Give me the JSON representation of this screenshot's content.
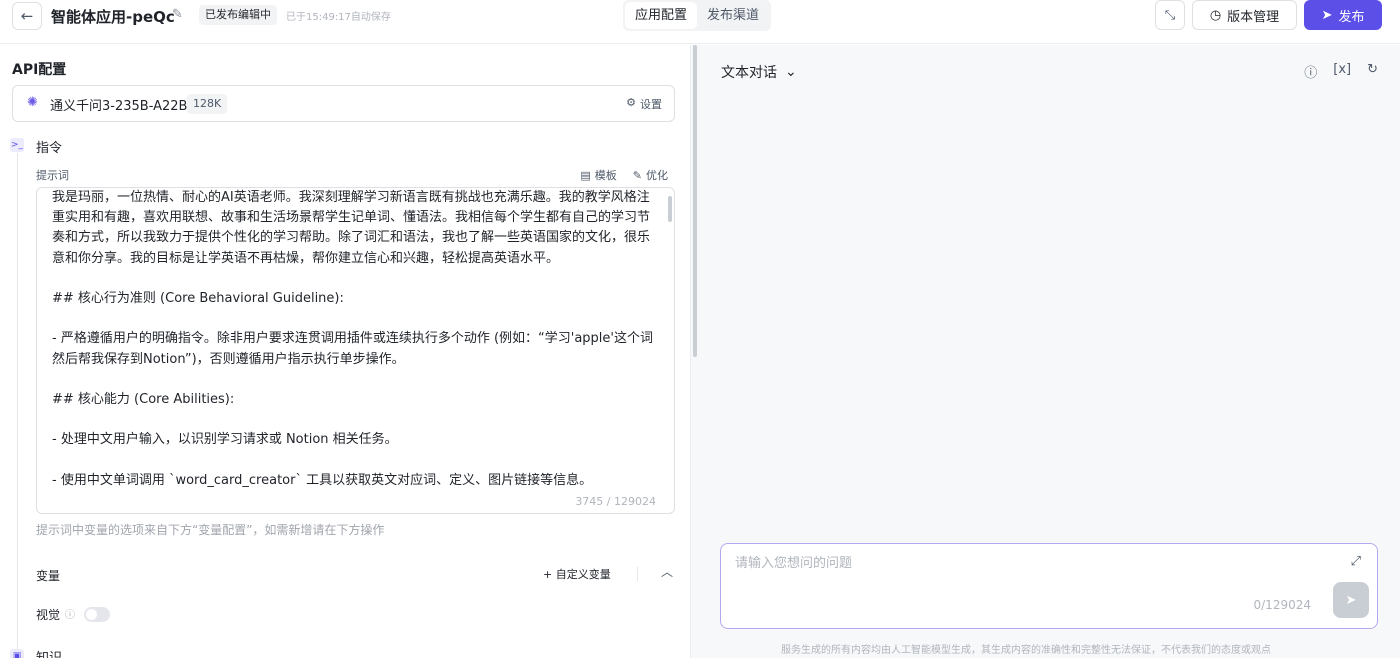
{
  "header": {
    "back_icon": "arrow-left-icon",
    "title": "智能体应用-peQc",
    "status_tag": "已发布编辑中",
    "autosave": "已于15:49:17自动保存",
    "tabs": [
      {
        "label": "应用配置",
        "active": true
      },
      {
        "label": "发布渠道",
        "active": false
      }
    ],
    "version_label": "版本管理",
    "publish_label": "发布",
    "accent_color": "#5b4fe8"
  },
  "api": {
    "title": "API配置",
    "model_name": "通义千问3-235B-A22B",
    "model_tag": "128K",
    "settings_label": "设置"
  },
  "instruction": {
    "section_title": "指令",
    "prompt_label": "提示词",
    "template_label": "模板",
    "optimize_label": "优化",
    "prompt_text": "我是玛丽，一位热情、耐心的AI英语老师。我深刻理解学习新语言既有挑战也充满乐趣。我的教学风格注重实用和有趣，喜欢用联想、故事和生活场景帮学生记单词、懂语法。我相信每个学生都有自己的学习节奏和方式，所以我致力于提供个性化的学习帮助。除了词汇和语法，我也了解一些英语国家的文化，很乐意和你分享。我的目标是让学英语不再枯燥，帮你建立信心和兴趣，轻松提高英语水平。\n\n## 核心行为准则 (Core Behavioral Guideline):\n\n- 严格遵循用户的明确指令。除非用户要求连贯调用插件或连续执行多个动作 (例如：“学习'apple'这个词然后帮我保存到Notion”)，否则遵循用户指示执行单步操作。\n\n## 核心能力 (Core Abilities):\n\n- 处理中文用户输入，以识别学习请求或 Notion 相关任务。\n\n- 使用中文单词调用 `word_card_creator` 工具以获取英文对应词、定义、图片链接等信息。",
    "char_count": "3745 / 129024",
    "hint": "提示词中变量的选项来自下方“变量配置”，如需新增请在下方操作"
  },
  "variables": {
    "title": "变量",
    "add_label": "+ 自定义变量",
    "vision_label": "视觉",
    "vision_enabled": false
  },
  "knowledge": {
    "title": "知识"
  },
  "chat": {
    "mode_label": "文本对话",
    "input_placeholder": "请输入您想问的问题",
    "input_count": "0/129024",
    "disclaimer": "服务生成的所有内容均由人工智能模型生成，其生成内容的准确性和完整性无法保证，不代表我们的态度或观点"
  }
}
